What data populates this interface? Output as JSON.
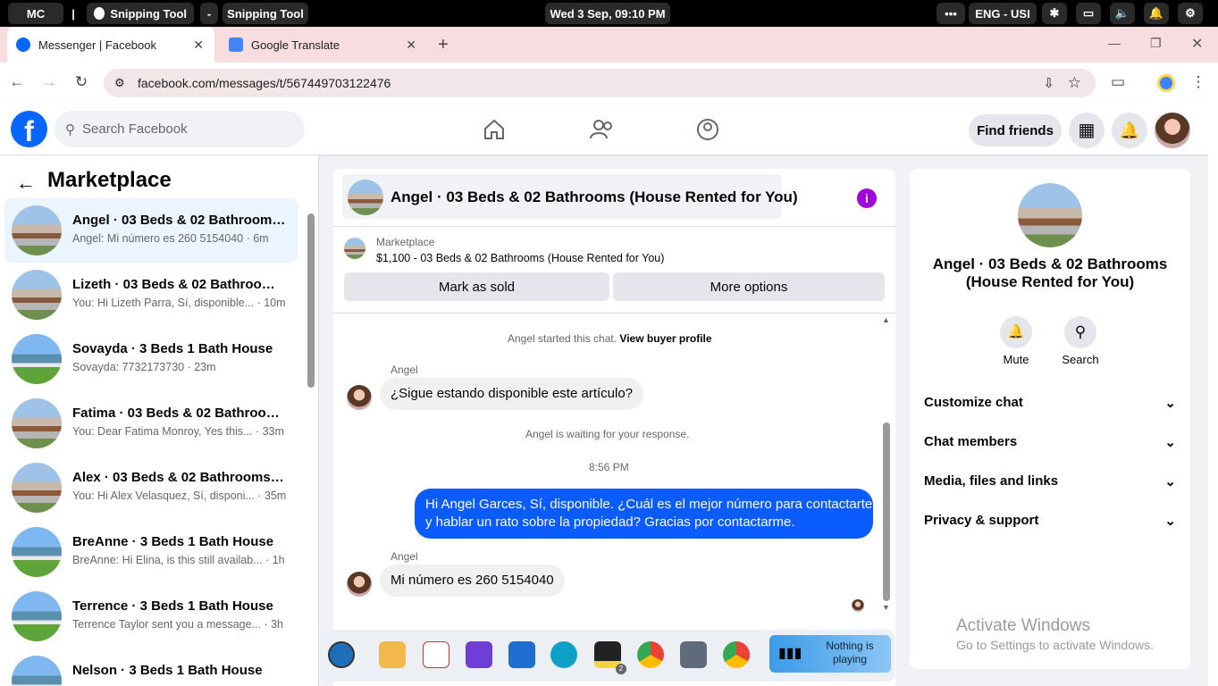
{
  "taskbar": {
    "user": "MC",
    "sep1": "|",
    "app1": "Snipping Tool",
    "dash": "-",
    "app2": "Snipping Tool",
    "datetime": "Wed 3 Sep, 09:10 PM",
    "more": "•••",
    "lang": "ENG - USI"
  },
  "browser": {
    "tabs": [
      {
        "title": "Messenger | Facebook",
        "active": true
      },
      {
        "title": "Google Translate",
        "active": false
      }
    ],
    "url": "facebook.com/messages/t/567449703122476",
    "new_tab": "+"
  },
  "fb": {
    "search_placeholder": "Search Facebook",
    "find_friends": "Find friends"
  },
  "sidebar": {
    "title": "Marketplace",
    "conversations": [
      {
        "name": "Angel · 03 Beds & 02 Bathrooms...",
        "preview": "Angel: Mi número es 260 5154040 · 6m",
        "avatar": "house-red",
        "selected": true
      },
      {
        "name": "Lizeth · 03 Beds & 02 Bathrooms...",
        "preview": "You: Hi Lizeth Parra, Sí, disponible... · 10m",
        "avatar": "house-red"
      },
      {
        "name": "Sovayda · 3 Beds 1 Bath House",
        "preview": "Sovayda: 7732173730 · 23m",
        "avatar": "house-blue"
      },
      {
        "name": "Fatima · 03 Beds & 02 Bathroom...",
        "preview": "You: Dear Fatima Monroy, Yes this... · 33m",
        "avatar": "house-red"
      },
      {
        "name": "Alex · 03 Beds & 02 Bathrooms (...",
        "preview": "You: Hi Alex Velasquez, Sí, disponi... · 35m",
        "avatar": "house-red"
      },
      {
        "name": "BreAnne · 3 Beds 1 Bath House",
        "preview": "BreAnne: Hi Elina, is this still availab... · 1h",
        "avatar": "house-blue"
      },
      {
        "name": "Terrence · 3 Beds 1 Bath House",
        "preview": "Terrence Taylor sent you a message... · 3h",
        "avatar": "house-blue"
      },
      {
        "name": "Nelson · 3 Beds 1 Bath House",
        "preview": "",
        "avatar": "house-blue"
      }
    ]
  },
  "chat": {
    "title": "Angel · 03 Beds & 02 Bathrooms (House Rented for You)",
    "listing_label": "Marketplace",
    "listing_title": "$1,100 - 03 Beds & 02 Bathrooms (House Rented for You)",
    "mark_sold": "Mark as sold",
    "more_options": "More options",
    "started": "Angel started this chat.",
    "view_profile": "View buyer profile",
    "sender1": "Angel",
    "msg1": "¿Sigue estando disponible este artículo?",
    "waiting": "Angel is waiting for your response.",
    "time": "8:56 PM",
    "my_msg_line1": "Hi Angel Garces, Sí, disponible. ¿Cuál es el mejor número para contactarte",
    "my_msg_line2": "y hablar un rato sobre la propiedad? Gracias por contactarme.",
    "sender2": "Angel",
    "msg2": "Mi número es 260 5154040"
  },
  "info": {
    "name_line1": "Angel · 03 Beds & 02 Bathrooms",
    "name_line2": "(House Rented for You)",
    "mute": "Mute",
    "search": "Search",
    "sections": [
      "Customize chat",
      "Chat members",
      "Media, files and links",
      "Privacy & support"
    ],
    "watermark1": "Activate Windows",
    "watermark2": "Go to Settings to activate Windows."
  },
  "dock": {
    "media_line1": "Nothing is",
    "media_line2": "playing",
    "badge": "2"
  },
  "colors": {
    "fb_blue": "#0866ff",
    "bubble_blue": "#0a5cff",
    "purple": "#a200e0"
  }
}
